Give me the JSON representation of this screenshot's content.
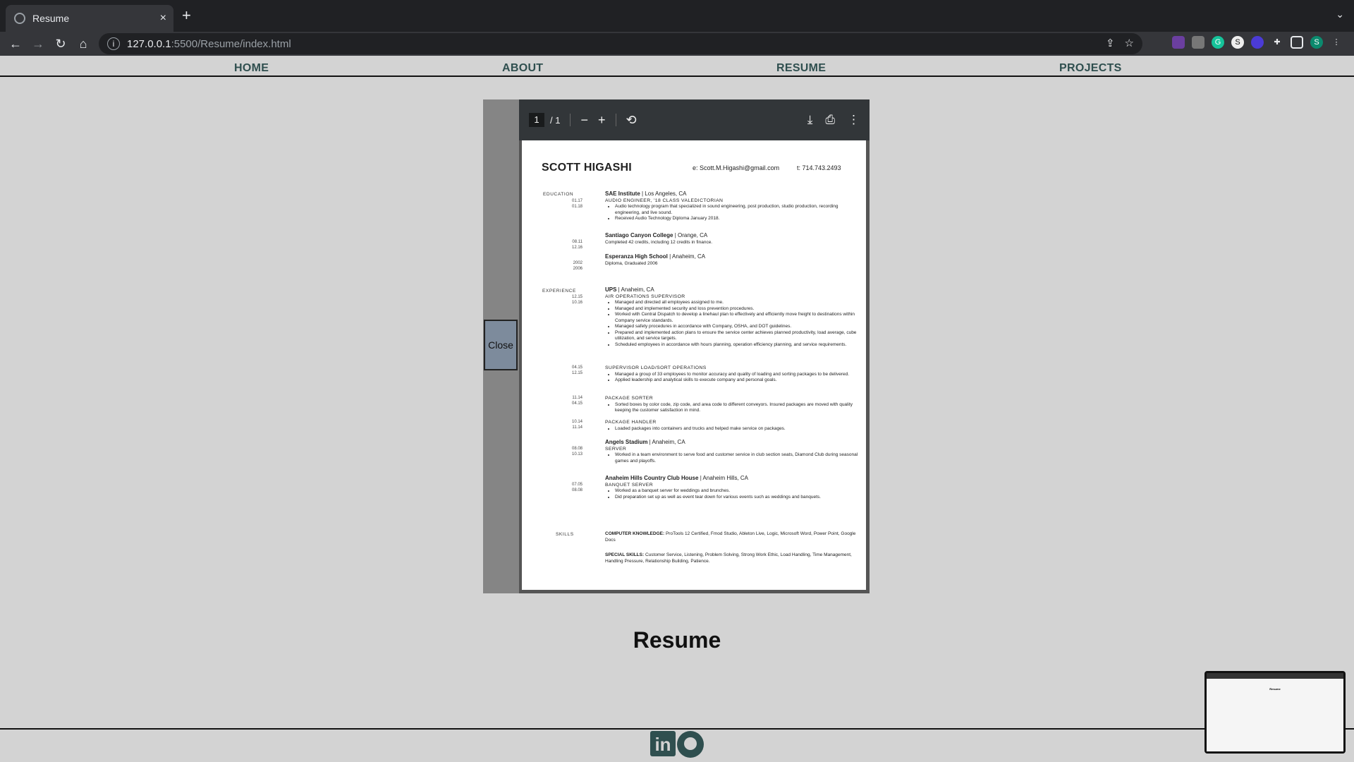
{
  "browser": {
    "tab_title": "Resume",
    "tab_close": "×",
    "new_tab": "+",
    "url_host": "127.0.0.1",
    "url_path": ":5500/Resume/index.html"
  },
  "nav": {
    "home": "HOME",
    "about": "ABOUT",
    "resume": "RESUME",
    "projects": "PROJECTS"
  },
  "viewer": {
    "close_label": "Close",
    "page_current": "1",
    "page_total": "/ 1"
  },
  "resume": {
    "name": "SCOTT HIGASHI",
    "email": "e: Scott.M.Higashi@gmail.com",
    "phone": "t: 714.743.2493",
    "labels": {
      "education": "EDUCATION",
      "experience": "EXPERIENCE",
      "skills": "SKILLS"
    },
    "education": [
      {
        "org": "SAE Institute",
        "loc": " | Los Angeles, CA",
        "dates": [
          "01.17",
          "01.18"
        ],
        "role": "AUDIO ENGINEER, '18 CLASS VALEDICTORIAN",
        "bullets": [
          "Audio technology program that specialized in sound engineering, post production, studio production, recording engineering, and live sound.",
          "Received Audio Technology Diploma January 2018."
        ]
      },
      {
        "org": "Santiago Canyon College",
        "loc": " | Orange, CA",
        "dates": [
          "08.11",
          "12.16"
        ],
        "line": "Completed 42 credits, including 12 credits in finance."
      },
      {
        "org": "Esperanza High School",
        "loc": " | Anaheim, CA",
        "dates": [
          "2002",
          "2006"
        ],
        "line": "Diploma, Graduated 2006"
      }
    ],
    "experience": {
      "ups_org": "UPS",
      "ups_loc": " | Anaheim, CA",
      "ups_dates": [
        "12.15",
        "10.16"
      ],
      "ups_role": "AIR OPERATIONS SUPERVISOR",
      "ups_bullets": [
        "Managed and directed all employees assigned to me.",
        "Managed and implemented security and loss prevention procedures.",
        "Worked with Central Dispatch to develop a linehaul plan to effectively and efficiently move freight to destinations within Company service standards.",
        "Managed safety procedures in accordance with Company, OSHA, and DOT guidelines.",
        "Prepared and implemented action plans to ensure the service center achieves planned productivity, load average, cube utilization, and service targets.",
        "Scheduled employees in accordance with hours planning, operation efficiency planning, and service requirements."
      ],
      "sup_dates": [
        "04.15",
        "12.15"
      ],
      "sup_role": "SUPERVISOR LOAD/SORT OPERATIONS",
      "sup_bullets": [
        "Managed a group of 33 employees to monitor accuracy and quality of loading and sorting packages to be delivered.",
        "Applied leadership and analytical skills to execute company and personal goals."
      ],
      "sorter_dates": [
        "11.14",
        "04.15"
      ],
      "sorter_role": "PACKAGE SORTER",
      "sorter_bullets": [
        "Sorted boxes by color code, zip code, and area code to different conveyors. Insured packages are moved with quality keeping the customer satisfaction in mind."
      ],
      "handler_dates": [
        "10.14",
        "11.14"
      ],
      "handler_role": "PACKAGE HANDLER",
      "handler_bullets": [
        "Loaded packages into containers and trucks and helped make service on packages."
      ],
      "angels_org": "Angels Stadium",
      "angels_loc": " | Anaheim, CA",
      "angels_dates": [
        "08.08",
        "10.13"
      ],
      "angels_role": "SERVER",
      "angels_bullets": [
        "Worked in a team environment to serve food and customer service in club section seats, Diamond Club during seasonal games and playoffs."
      ],
      "ahcc_org": "Anaheim Hills Country Club House",
      "ahcc_loc": " | Anaheim Hills, CA",
      "ahcc_dates": [
        "07.05",
        "08.08"
      ],
      "ahcc_role": "BANQUET SERVER",
      "ahcc_bullets": [
        "Worked as a banquet server for weddings and brunches.",
        "Did preparation set up as well as event tear down for various events such as weddings and banquets."
      ]
    },
    "skills": {
      "ck_label": "COMPUTER KNOWLEDGE:",
      "ck_text": "ProTools 12 Certified, Fmod Studio, Ableton Live, Logic, Microsoft Word, Power Point, Google Docs",
      "ss_label": "SPECIAL SKILLS:",
      "ss_text": "Customer Service, Listening, Problem Solving, Strong Work Ethic, Load Handling, Time Management, Handling Pressure, Relationship Building, Patience."
    }
  },
  "page_heading": "Resume",
  "thumb_title": "Resume",
  "social": {
    "linkedin": "in"
  }
}
